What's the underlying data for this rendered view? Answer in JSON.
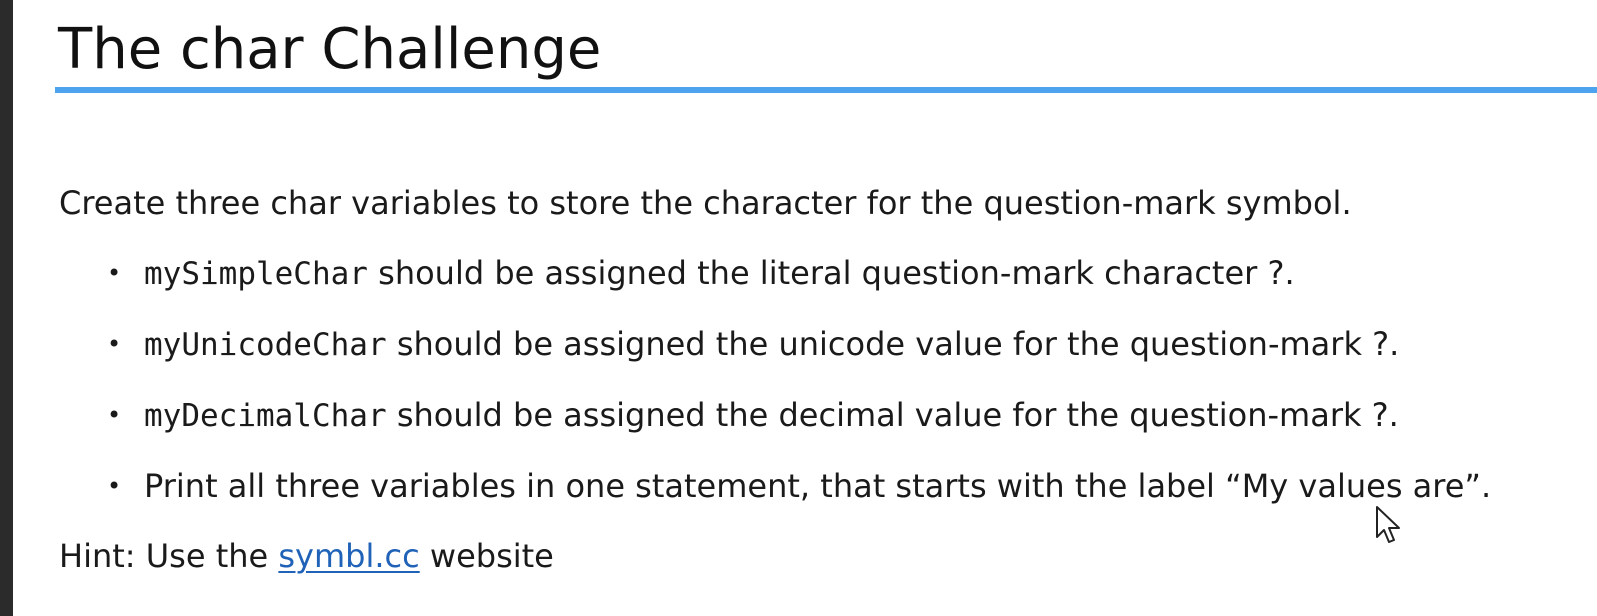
{
  "slide": {
    "title": "The char Challenge",
    "intro": "Create three char variables to store the character for the question-mark symbol.",
    "bullets": [
      {
        "code": "mySimpleChar",
        "text": " should be assigned the literal question-mark character ?."
      },
      {
        "code": "myUnicodeChar",
        "text": " should be assigned the unicode value for the question-mark ?."
      },
      {
        "code": "myDecimalChar",
        "text": " should be assigned the decimal value for the question-mark ?."
      },
      {
        "code": "",
        "text": "Print all three variables in one statement, that starts with the label “My values are”."
      }
    ],
    "bullet_glyph": "•",
    "hint": {
      "prefix": "Hint: Use the ",
      "link_text": "symbl.cc",
      "suffix": " website"
    }
  },
  "colors": {
    "accent_rule": "#4da3ee",
    "link": "#1f62b8",
    "left_bar": "#2b2b2b"
  },
  "icons": {
    "cursor": "mouse-pointer-icon",
    "bullet": "bullet-dot-icon"
  }
}
